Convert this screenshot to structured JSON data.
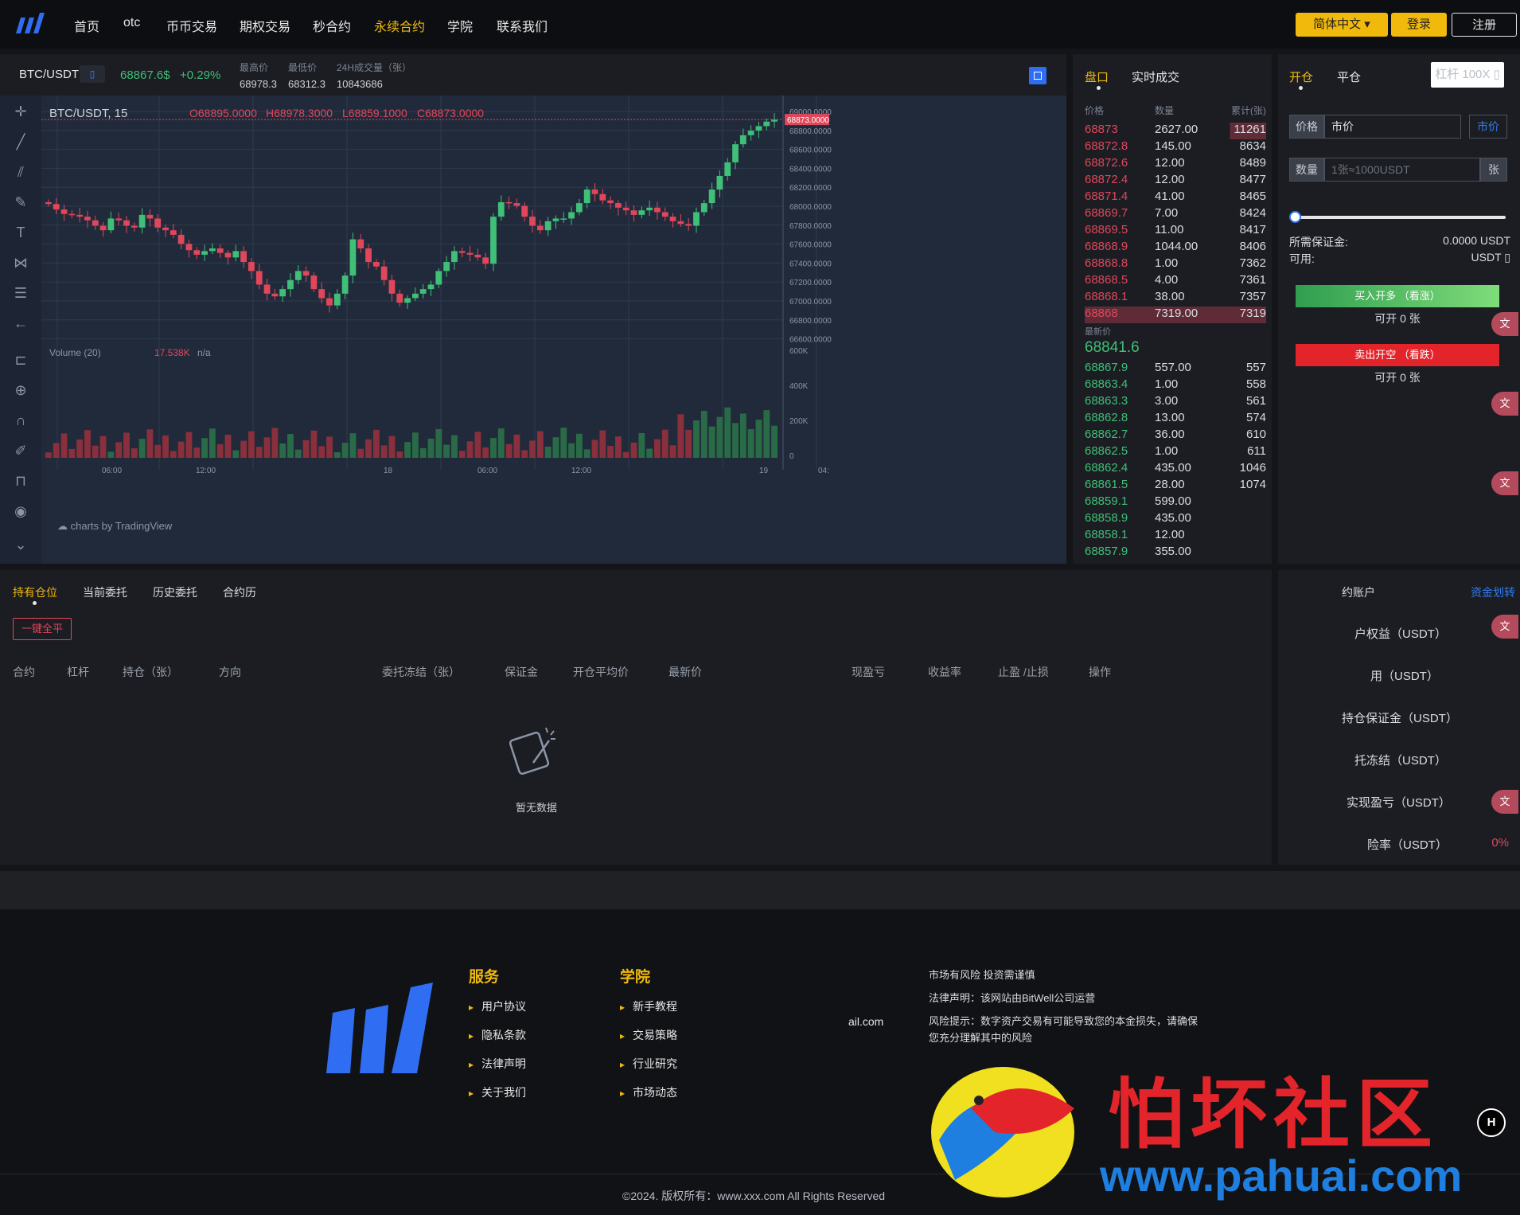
{
  "nav": {
    "items": [
      "首页",
      "otc",
      "币币交易",
      "期权交易",
      "秒合约",
      "永续合约",
      "学院",
      "联系我们"
    ],
    "active_index": 5,
    "lang": "简体中文 ▾",
    "login": "登录",
    "register": "注册"
  },
  "ticker": {
    "pair": "BTC/USDT",
    "pair_icon": "▯",
    "price": "68867.6$",
    "change": "+0.29%",
    "high_label": "最高价",
    "high": "68978.3",
    "low_label": "最低价",
    "low": "68312.3",
    "vol_label": "24H成交量（张）",
    "vol": "10843686"
  },
  "chart": {
    "legend_symbol": "BTC/USDT, 15",
    "open": "O68895.0000",
    "high": "H68978.3000",
    "low": "L68859.1000",
    "close": "C68873.0000",
    "volume_label": "Volume (20)",
    "volume_value": "17.538K",
    "volume_na": "n/a",
    "watermark": "charts by TradingView",
    "last_price_tag": "68873.0000",
    "price_ticks": [
      "69000.0000",
      "68800.0000",
      "68600.0000",
      "68400.0000",
      "68200.0000",
      "68000.0000",
      "67800.0000",
      "67600.0000",
      "67400.0000",
      "67200.0000",
      "67000.0000",
      "66800.0000",
      "66600.0000"
    ],
    "volume_ticks": [
      "600K",
      "400K",
      "200K",
      "0"
    ],
    "time_ticks": [
      "06:00",
      "12:00",
      "18",
      "06:00",
      "12:00",
      "19",
      "04:"
    ]
  },
  "chart_data": {
    "type": "candlestick",
    "title": "BTC/USDT, 15",
    "ylim": [
      66500,
      69050
    ],
    "close_series": [
      67940,
      67880,
      67830,
      67820,
      67800,
      67760,
      67700,
      67650,
      67780,
      67760,
      67700,
      67680,
      67820,
      67780,
      67680,
      67650,
      67600,
      67500,
      67430,
      67380,
      67420,
      67450,
      67400,
      67350,
      67420,
      67300,
      67200,
      67050,
      66950,
      66920,
      67000,
      67100,
      67200,
      67150,
      67000,
      66900,
      66820,
      66950,
      67150,
      67550,
      67450,
      67300,
      67250,
      67100,
      66950,
      66850,
      66900,
      66950,
      67000,
      67050,
      67200,
      67300,
      67420,
      67400,
      67380,
      67350,
      67280,
      67800,
      67960,
      67950,
      67920,
      67800,
      67700,
      67650,
      67750,
      67780,
      67780,
      67850,
      67950,
      68100,
      68050,
      67980,
      67950,
      67900,
      67870,
      67820,
      67870,
      67900,
      67850,
      67800,
      67750,
      67720,
      67700,
      67850,
      67950,
      68100,
      68250,
      68400,
      68600,
      68700,
      68750,
      68800,
      68850,
      68873
    ],
    "volume_max_k": 600
  },
  "orderbook": {
    "tab_book": "盘口",
    "tab_trades": "实时成交",
    "h_price": "价格",
    "h_qty": "数量",
    "h_total": "累计(张)",
    "asks": [
      [
        "68873",
        "2627.00",
        "11261"
      ],
      [
        "68872.8",
        "145.00",
        "8634"
      ],
      [
        "68872.6",
        "12.00",
        "8489"
      ],
      [
        "68872.4",
        "12.00",
        "8477"
      ],
      [
        "68871.4",
        "41.00",
        "8465"
      ],
      [
        "68869.7",
        "7.00",
        "8424"
      ],
      [
        "68869.5",
        "11.00",
        "8417"
      ],
      [
        "68868.9",
        "1044.00",
        "8406"
      ],
      [
        "68868.8",
        "1.00",
        "7362"
      ],
      [
        "68868.5",
        "4.00",
        "7361"
      ],
      [
        "68868.1",
        "38.00",
        "7357"
      ],
      [
        "68868",
        "7319.00",
        "7319"
      ]
    ],
    "last_label": "最新价",
    "last_price": "68841.6",
    "bids": [
      [
        "68867.9",
        "557.00",
        "557"
      ],
      [
        "68863.4",
        "1.00",
        "558"
      ],
      [
        "68863.3",
        "3.00",
        "561"
      ],
      [
        "68862.8",
        "13.00",
        "574"
      ],
      [
        "68862.7",
        "36.00",
        "610"
      ],
      [
        "68862.5",
        "1.00",
        "611"
      ],
      [
        "68862.4",
        "435.00",
        "1046"
      ],
      [
        "68861.5",
        "28.00",
        "1074"
      ],
      [
        "68859.1",
        "599.00",
        ""
      ],
      [
        "68858.9",
        "435.00",
        ""
      ],
      [
        "68858.1",
        "12.00",
        ""
      ],
      [
        "68857.9",
        "355.00",
        ""
      ]
    ]
  },
  "trade": {
    "tab_open": "开仓",
    "tab_close": "平仓",
    "leverage": "杠杆 100X ▯",
    "price_label": "价格",
    "price_value": "市价",
    "price_mode": "市价",
    "qty_label": "数量",
    "qty_placeholder": "1张≈1000USDT",
    "qty_unit": "张",
    "margin_label": "所需保证金:",
    "margin_value": "0.0000 USDT",
    "avail_label": "可用:",
    "avail_value": "USDT ▯",
    "buy_btn": "买入开多 （看涨）",
    "buy_can": "可开 0 张",
    "sell_btn": "卖出开空 （看跌）",
    "sell_can": "可开 0 张",
    "slider_level": 0
  },
  "positions": {
    "tabs": [
      "持有仓位",
      "当前委托",
      "历史委托",
      "合约历"
    ],
    "close_all": "一键全平",
    "columns": [
      "合约",
      "杠杆",
      "持仓（张）",
      "方向",
      "委托冻结（张）",
      "保证金",
      "开仓平均价",
      "最新价",
      "现盈亏",
      "收益率",
      "止盈 /止损",
      "操作"
    ],
    "empty": "暂无数据"
  },
  "account": {
    "title": "约账户",
    "transfer": "资金划转",
    "rows": [
      "户权益（USDT）",
      "用（USDT）",
      "持仓保证金（USDT）",
      "托冻结（USDT）",
      "实现盈亏（USDT）",
      "险率（USDT）"
    ],
    "risk_value": "0%"
  },
  "footer": {
    "services_title": "服务",
    "services": [
      "用户协议",
      "隐私条款",
      "法律声明",
      "关于我们"
    ],
    "academy_title": "学院",
    "academy": [
      "新手教程",
      "交易策略",
      "行业研究",
      "市场动态"
    ],
    "email": "ail.com",
    "notice1": "市场有风险 投资需谨慎",
    "notice2": "法律声明：该网站由BitWell公司运营",
    "notice3": "风险提示：数字资产交易有可能导致您的本金损失，请确保您充分理解其中的风险",
    "copyright": "©2024. 版权所有：www.xxx.com All Rights Reserved",
    "watermark_cn": "怕坏社区",
    "watermark_url": "www.pahuai.com"
  }
}
